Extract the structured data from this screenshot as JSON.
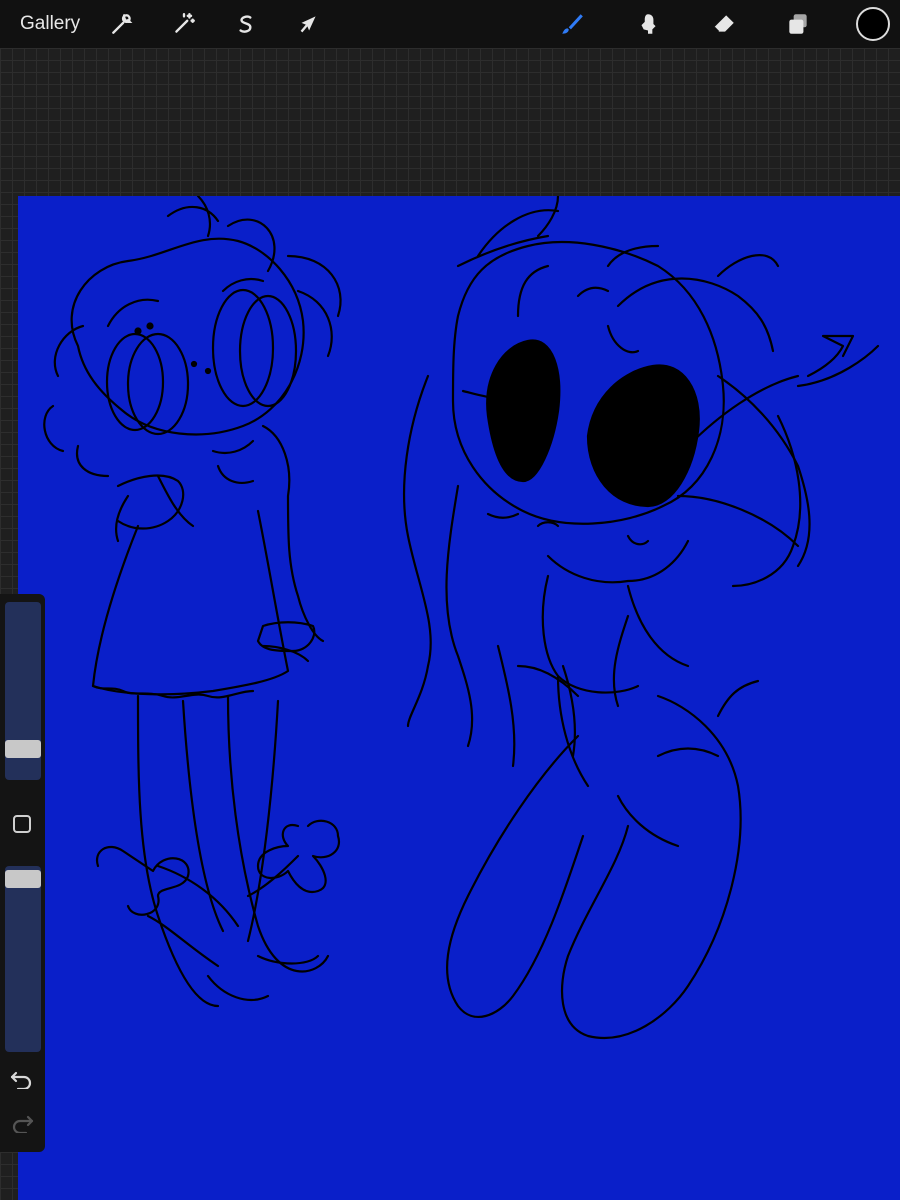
{
  "toolbar": {
    "gallery_label": "Gallery",
    "left_tools": [
      "wrench-icon",
      "magic-wand-icon",
      "selection-icon",
      "transform-arrow-icon"
    ],
    "right_tools": [
      "brush-icon",
      "smudge-icon",
      "eraser-icon",
      "layers-icon"
    ],
    "active_tool": "brush-icon",
    "active_color": "#000000",
    "accent_color": "#2f7bf6"
  },
  "canvas": {
    "background_color": "#0a1fc9",
    "line_color": "#000000"
  },
  "sidebar": {
    "brush_size_level": 0.2,
    "opacity_level": 0.9,
    "icons": [
      "modify-square-icon",
      "undo-icon",
      "redo-icon"
    ]
  }
}
